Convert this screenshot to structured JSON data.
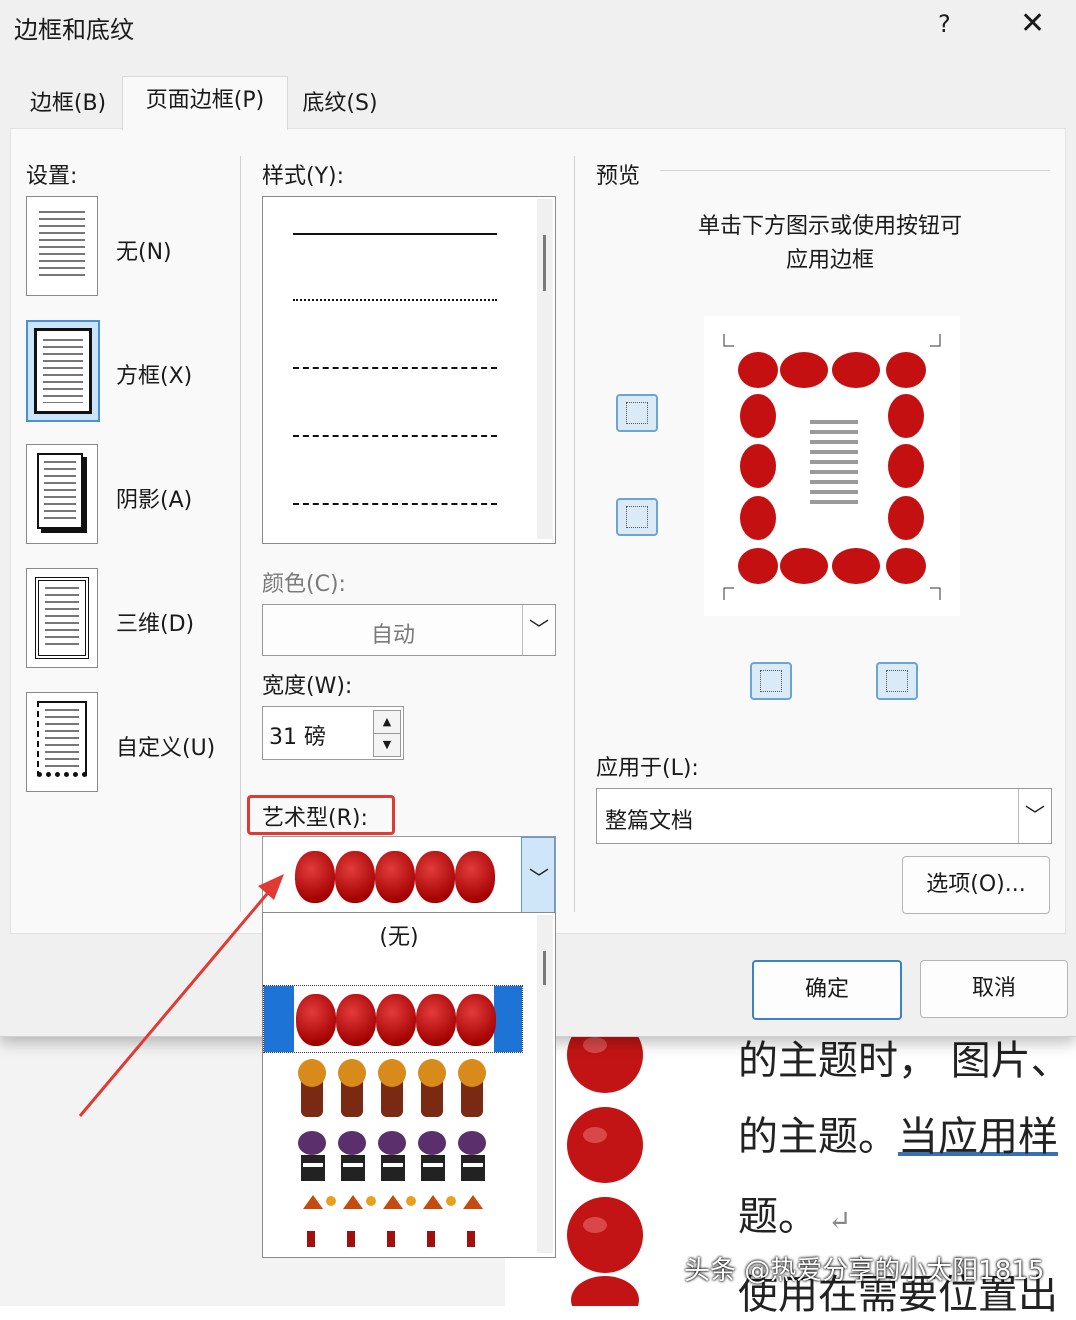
{
  "dialog": {
    "title": "边框和底纹",
    "help_label": "?",
    "close_label": "✕"
  },
  "tabs": [
    {
      "label": "边框(B)",
      "active": false
    },
    {
      "label": "页面边框(P)",
      "active": true
    },
    {
      "label": "底纹(S)",
      "active": false
    }
  ],
  "settings": {
    "label": "设置:",
    "items": [
      {
        "label": "无(N)",
        "selected": false
      },
      {
        "label": "方框(X)",
        "selected": true
      },
      {
        "label": "阴影(A)",
        "selected": false
      },
      {
        "label": "三维(D)",
        "selected": false
      },
      {
        "label": "自定义(U)",
        "selected": false
      }
    ]
  },
  "style": {
    "label": "样式(Y):"
  },
  "color": {
    "label": "颜色(C):",
    "value": "自动"
  },
  "width": {
    "label": "宽度(W):",
    "value": "31 磅"
  },
  "art": {
    "label": "艺术型(R):",
    "none_option": "(无)"
  },
  "preview": {
    "label": "预览",
    "hint_line1": "单击下方图示或使用按钮可",
    "hint_line2": "应用边框"
  },
  "apply": {
    "label": "应用于(L):",
    "value": "整篇文档"
  },
  "buttons": {
    "options": "选项(O)...",
    "ok": "确定",
    "cancel": "取消"
  },
  "document": {
    "line1": "的主题时， 图片、",
    "line2_plain": "的主题。",
    "line2_link": "当应用样",
    "line3": "题。",
    "return_mark": "↵",
    "line4": "使用在需要位置出"
  },
  "watermark": "头条 @热爱分享的小太阳1815",
  "colors": {
    "accent": "#3d82c9",
    "highlight_red": "#e03a35",
    "apple_red": "#c00000"
  }
}
